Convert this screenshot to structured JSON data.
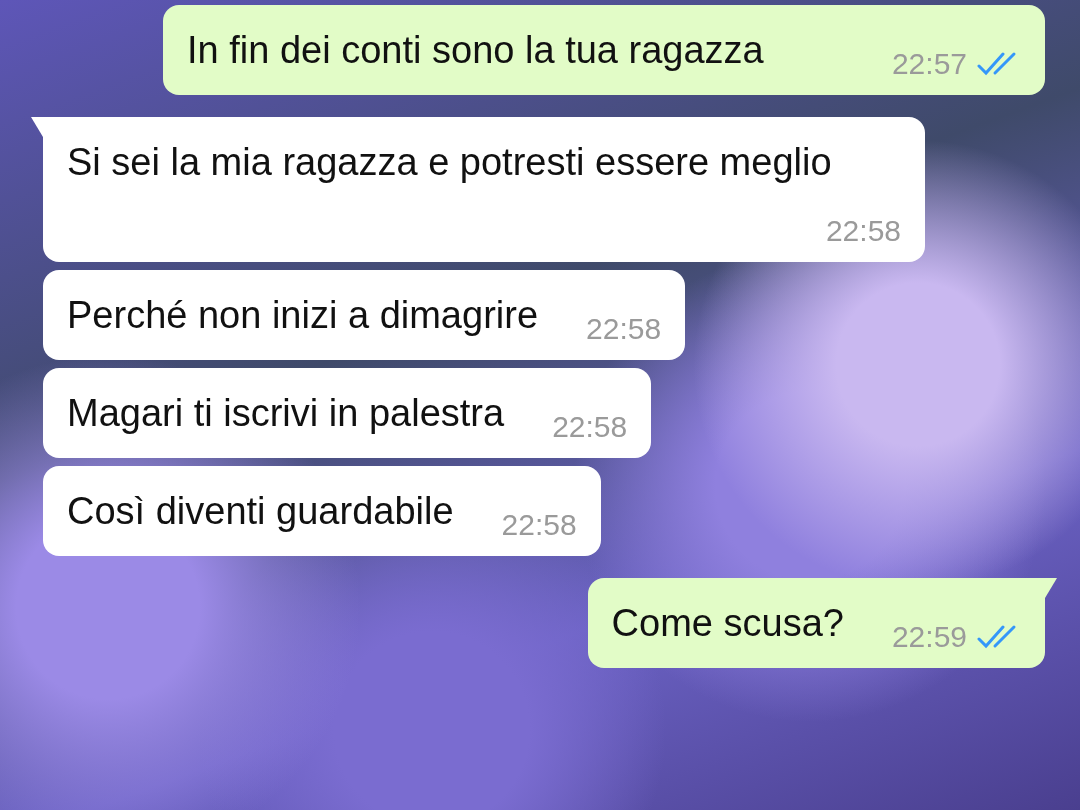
{
  "messages": [
    {
      "kind": "sent",
      "text": "In fin dei conti sono la tua ragazza",
      "time": "22:57",
      "read": true,
      "tail": false
    },
    {
      "kind": "received",
      "text": "Si sei la mia ragazza e potresti essere meglio",
      "time": "22:58",
      "tail": true
    },
    {
      "kind": "received",
      "text": "Perché non inizi a dimagrire",
      "time": "22:58",
      "tail": false
    },
    {
      "kind": "received",
      "text": "Magari ti iscrivi in palestra",
      "time": "22:58",
      "tail": false
    },
    {
      "kind": "received",
      "text": "Così diventi guardabile",
      "time": "22:58",
      "tail": false
    },
    {
      "kind": "sent",
      "text": "Come scusa?",
      "time": "22:59",
      "read": true,
      "tail": true
    }
  ]
}
